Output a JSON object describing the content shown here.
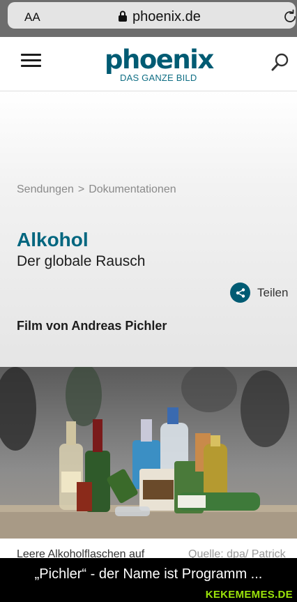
{
  "browser": {
    "text_size_label": "AA",
    "url": "phoenix.de",
    "icons": [
      "lock-icon",
      "reload-icon"
    ]
  },
  "header": {
    "logo_main": "phoenix",
    "logo_sub": "DAS GANZE BILD",
    "brand_color": "#005b73",
    "icons": [
      "hamburger-menu-icon",
      "search-icon"
    ]
  },
  "breadcrumb": {
    "items": [
      "Sendungen",
      "Dokumentationen"
    ],
    "separator": ">"
  },
  "article": {
    "title": "Alkohol",
    "subtitle": "Der globale Rausch",
    "share_label": "Teilen",
    "byline": "Film von Andreas Pichler"
  },
  "photo": {
    "caption": "Leere Alkoholflaschen auf",
    "source": "Quelle: dpa/ Patrick"
  },
  "meme": {
    "caption": "„Pichler“ - der Name ist Programm ...",
    "watermark": "KEKEMEMES.DE",
    "watermark_color": "#9be30a"
  }
}
